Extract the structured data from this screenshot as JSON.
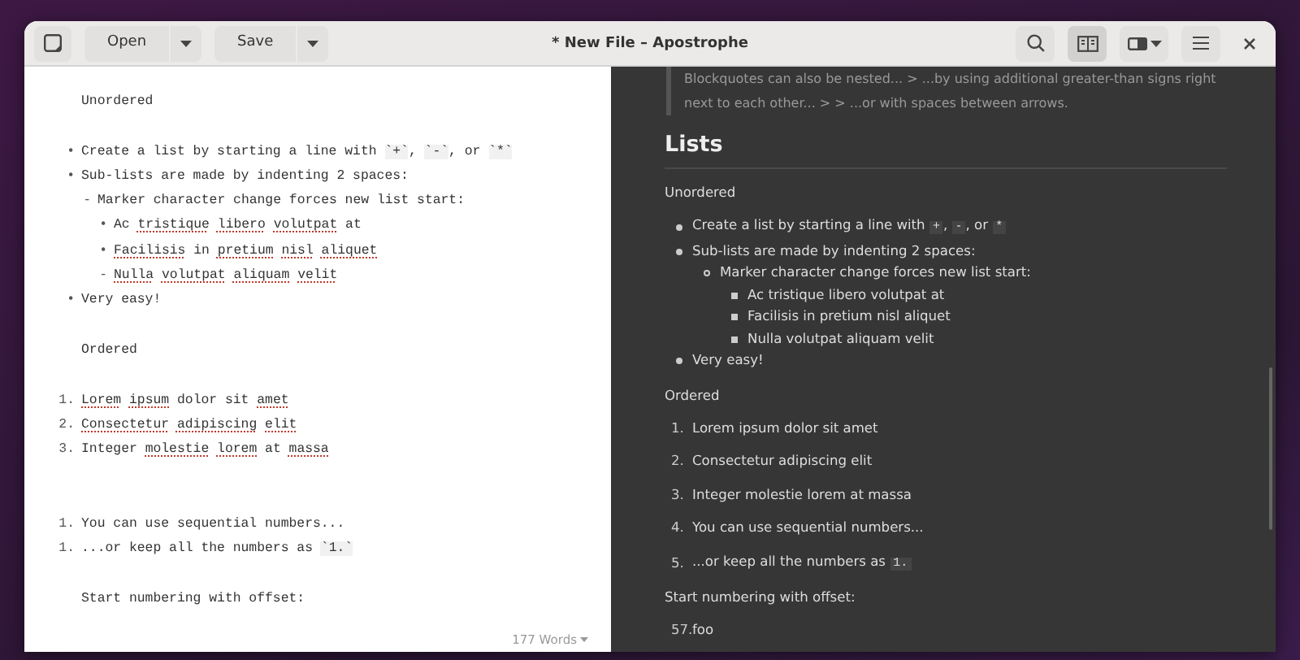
{
  "window": {
    "title": "* New File – Apostrophe"
  },
  "header": {
    "file_buttons": [
      {
        "label": "Open",
        "dropdown": true
      },
      {
        "label": "Save",
        "dropdown": true
      }
    ],
    "view_buttons": [
      {
        "kind": "search",
        "selected": false
      },
      {
        "kind": "preview",
        "selected": true
      },
      {
        "kind": "layout",
        "selected": false
      },
      {
        "kind": "menu",
        "selected": false
      }
    ]
  },
  "editor": {
    "lines": [
      {
        "kind": "para",
        "segments": [
          {
            "text": "Unordered"
          }
        ]
      },
      {
        "kind": "blank"
      },
      {
        "kind": "item",
        "marker": "•",
        "segments": [
          {
            "text": "Create a list by starting a line with "
          },
          {
            "text": "`+`",
            "code": true
          },
          {
            "text": ", "
          },
          {
            "text": "`-`",
            "code": true
          },
          {
            "text": ", or "
          },
          {
            "text": "`*`",
            "code": true
          }
        ]
      },
      {
        "kind": "item",
        "marker": "•",
        "segments": [
          {
            "text": "Sub-lists are made by indenting 2 spaces:"
          }
        ],
        "children": [
          {
            "kind": "item",
            "marker": "-",
            "segments": [
              {
                "text": "Marker character change forces new list start:"
              }
            ],
            "children": [
              {
                "kind": "item",
                "marker": "•",
                "segments": [
                  {
                    "text": "Ac "
                  },
                  {
                    "text": "tristique libero volutpat",
                    "misspelled": true
                  },
                  {
                    "text": " at"
                  }
                ]
              },
              {
                "kind": "item",
                "marker": "•",
                "segments": [
                  {
                    "text": "Facilisis",
                    "misspelled": true
                  },
                  {
                    "text": " in "
                  },
                  {
                    "text": "pretium nisl aliquet",
                    "misspelled": true
                  }
                ]
              },
              {
                "kind": "item",
                "marker": "-",
                "segments": [
                  {
                    "text": "Nulla volutpat aliquam velit",
                    "misspelled": true
                  }
                ]
              }
            ]
          }
        ]
      },
      {
        "kind": "item",
        "marker": "•",
        "segments": [
          {
            "text": "Very easy!"
          }
        ]
      },
      {
        "kind": "blank"
      },
      {
        "kind": "para",
        "segments": [
          {
            "text": "Ordered"
          }
        ]
      },
      {
        "kind": "blank"
      },
      {
        "kind": "item",
        "marker": "1.",
        "segments": [
          {
            "text": "Lorem ipsum",
            "misspelled": true
          },
          {
            "text": " dolor sit "
          },
          {
            "text": "amet",
            "misspelled": true
          }
        ]
      },
      {
        "kind": "item",
        "marker": "2.",
        "segments": [
          {
            "text": "Consectetur adipiscing elit",
            "misspelled": true
          }
        ]
      },
      {
        "kind": "item",
        "marker": "3.",
        "segments": [
          {
            "text": "Integer "
          },
          {
            "text": "molestie lorem",
            "misspelled": true
          },
          {
            "text": " at "
          },
          {
            "text": "massa",
            "misspelled": true
          }
        ]
      },
      {
        "kind": "blank"
      },
      {
        "kind": "blank"
      },
      {
        "kind": "item",
        "marker": "1.",
        "segments": [
          {
            "text": "You can use sequential numbers..."
          }
        ]
      },
      {
        "kind": "item",
        "marker": "1.",
        "segments": [
          {
            "text": "...or keep all the numbers as "
          },
          {
            "text": "`1.`",
            "code": true
          }
        ]
      },
      {
        "kind": "blank"
      },
      {
        "kind": "para",
        "segments": [
          {
            "text": "Start numbering with offset:"
          }
        ]
      }
    ],
    "word_count": "177 Words"
  },
  "preview": {
    "blocks": [
      {
        "kind": "blockquote",
        "text": "Blockquotes can also be nested... > ...by using additional greater-than signs right next to each other... > > ...or with spaces between arrows."
      },
      {
        "kind": "heading",
        "text": "Lists"
      },
      {
        "kind": "para",
        "text": "Unordered"
      },
      {
        "kind": "ul",
        "items": [
          {
            "segments": [
              {
                "text": "Create a list by starting a line with "
              },
              {
                "text": "+",
                "code": true
              },
              {
                "text": ", "
              },
              {
                "text": "-",
                "code": true
              },
              {
                "text": ", or "
              },
              {
                "text": "*",
                "code": true
              }
            ]
          },
          {
            "segments": [
              {
                "text": "Sub-lists are made by indenting 2 spaces:"
              }
            ],
            "children": [
              {
                "segments": [
                  {
                    "text": "Marker character change forces new list start:"
                  }
                ],
                "children": [
                  {
                    "segments": [
                      {
                        "text": "Ac tristique libero volutpat at"
                      }
                    ]
                  },
                  {
                    "segments": [
                      {
                        "text": "Facilisis in pretium nisl aliquet"
                      }
                    ]
                  },
                  {
                    "segments": [
                      {
                        "text": "Nulla volutpat aliquam velit"
                      }
                    ]
                  }
                ]
              }
            ]
          },
          {
            "segments": [
              {
                "text": "Very easy!"
              }
            ]
          }
        ]
      },
      {
        "kind": "para",
        "text": "Ordered"
      },
      {
        "kind": "ol",
        "items": [
          {
            "number": "1.",
            "segments": [
              {
                "text": "Lorem ipsum dolor sit amet"
              }
            ]
          },
          {
            "number": "2.",
            "segments": [
              {
                "text": "Consectetur adipiscing elit"
              }
            ]
          },
          {
            "number": "3.",
            "segments": [
              {
                "text": "Integer molestie lorem at massa"
              }
            ]
          },
          {
            "number": "4.",
            "segments": [
              {
                "text": "You can use sequential numbers..."
              }
            ]
          },
          {
            "number": "5.",
            "segments": [
              {
                "text": "...or keep all the numbers as "
              },
              {
                "text": "1.",
                "code": true
              }
            ]
          }
        ]
      },
      {
        "kind": "para",
        "text": "Start numbering with offset:"
      },
      {
        "kind": "ol",
        "items": [
          {
            "number": "57.",
            "segments": [
              {
                "text": "foo"
              }
            ]
          }
        ]
      }
    ]
  }
}
